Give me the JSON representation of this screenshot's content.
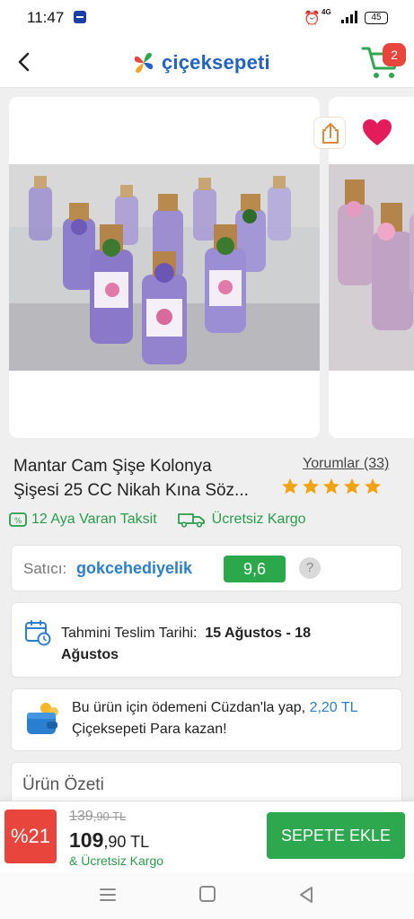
{
  "status": {
    "time": "11:47",
    "network": "4G",
    "battery": "45"
  },
  "header": {
    "logo_text": "çiçeksepeti",
    "cart_count": "2",
    "colors": {
      "brand_blue": "#2163c4",
      "cart_green": "#2ea84e",
      "badge_red": "#e8453c"
    }
  },
  "gallery": {
    "icons": [
      "share-icon",
      "heart-icon"
    ]
  },
  "product": {
    "title_line1": "Mantar Cam Şişe Kolonya",
    "title_line2": "Şişesi 25 CC Nikah Kına Söz...",
    "reviews_label": "Yorumlar (33)",
    "rating": 5,
    "rating_max": 5,
    "perk_installment": "12 Aya Varan Taksit",
    "perk_shipping": "Ücretsiz Kargo"
  },
  "seller": {
    "label": "Satıcı:",
    "name": "gokcehediyelik",
    "score": "9,6",
    "help": "?"
  },
  "delivery": {
    "label": "Tahmini Teslim Tarihi:",
    "dates": "15 Ağustos - 18 Ağustos"
  },
  "wallet": {
    "text_before": "Bu ürün için ödemeni Cüzdan'la yap,",
    "amount": "2,20 TL",
    "text_after": "Çiçeksepeti Para kazan!"
  },
  "summary": {
    "title": "Ürün Özeti"
  },
  "purchase": {
    "discount": "%21",
    "old_price_main": "139",
    "old_price_dec": ",90 TL",
    "new_price_main": "109",
    "new_price_dec": ",90 TL",
    "shipping_note": "& Ücretsiz Kargo",
    "add_to_cart": "SEPETE EKLE"
  }
}
